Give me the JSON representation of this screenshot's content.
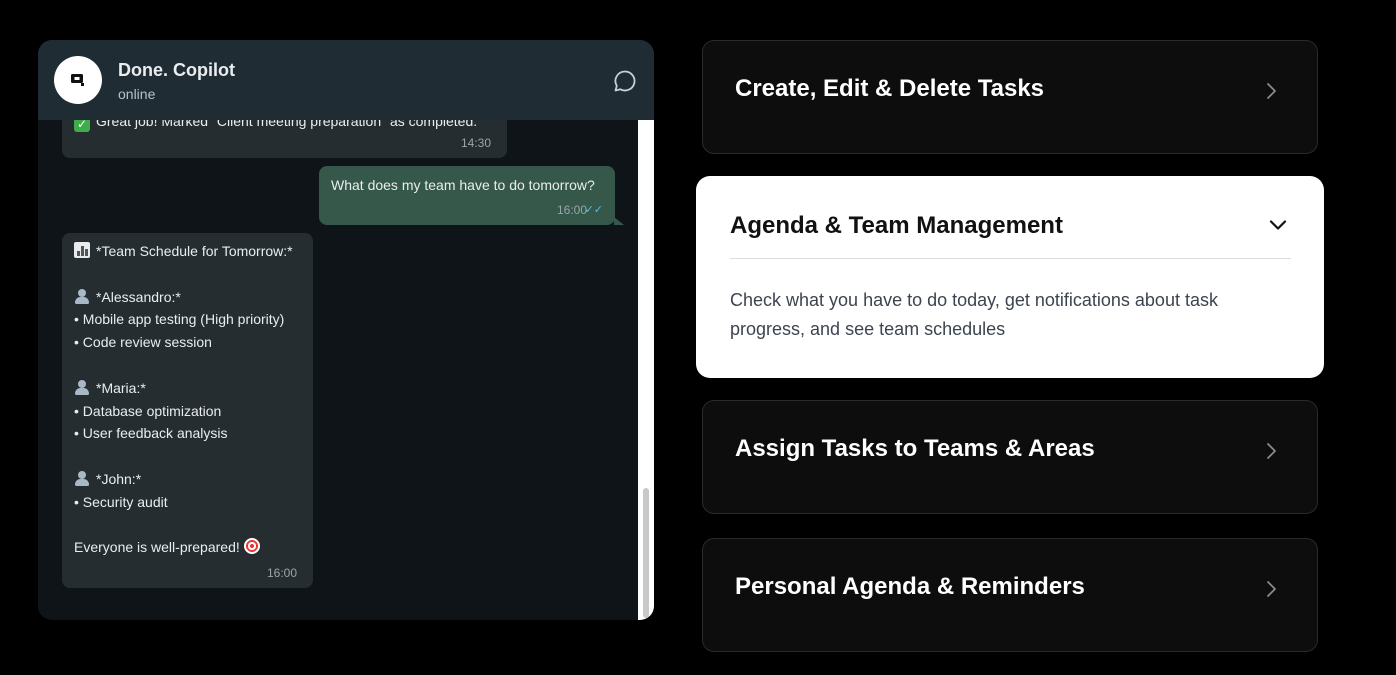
{
  "chat": {
    "title": "Done. Copilot",
    "status": "online",
    "avatar_icon": "done-logo-icon",
    "header_icon": "chat-bubble-icon",
    "colors": {
      "header": "#202c33",
      "background": "#0f1418",
      "incoming": "#262d31",
      "outgoing": "#35584a",
      "read_ticks": "#53bdeb"
    },
    "messages": [
      {
        "direction": "incoming",
        "text": "Great job! Marked \"Client meeting preparation\" as completed.",
        "time": "14:30"
      },
      {
        "direction": "outgoing",
        "text": "What does my team have to do tomorrow?",
        "time": "16:00",
        "status_icon": "double-check-icon"
      },
      {
        "direction": "incoming",
        "time": "16:00",
        "lines": [
          "*Team Schedule for Tomorrow:*",
          "",
          "*Alessandro:*",
          "• Mobile app testing (High priority)",
          "• Code review session",
          "",
          "*Maria:*",
          "• Database optimization",
          "• User feedback analysis",
          "",
          "*John:*",
          "• Security audit",
          "",
          "Everyone is well-prepared!"
        ]
      }
    ]
  },
  "features": {
    "items": [
      {
        "title": "Create, Edit & Delete Tasks",
        "expanded": false
      },
      {
        "title": "Agenda & Team Management",
        "expanded": true,
        "description": "Check what you have to do today, get notifications about task progress, and see team schedules"
      },
      {
        "title": "Assign Tasks to Teams & Areas",
        "expanded": false
      },
      {
        "title": "Personal Agenda & Reminders",
        "expanded": false
      }
    ]
  }
}
